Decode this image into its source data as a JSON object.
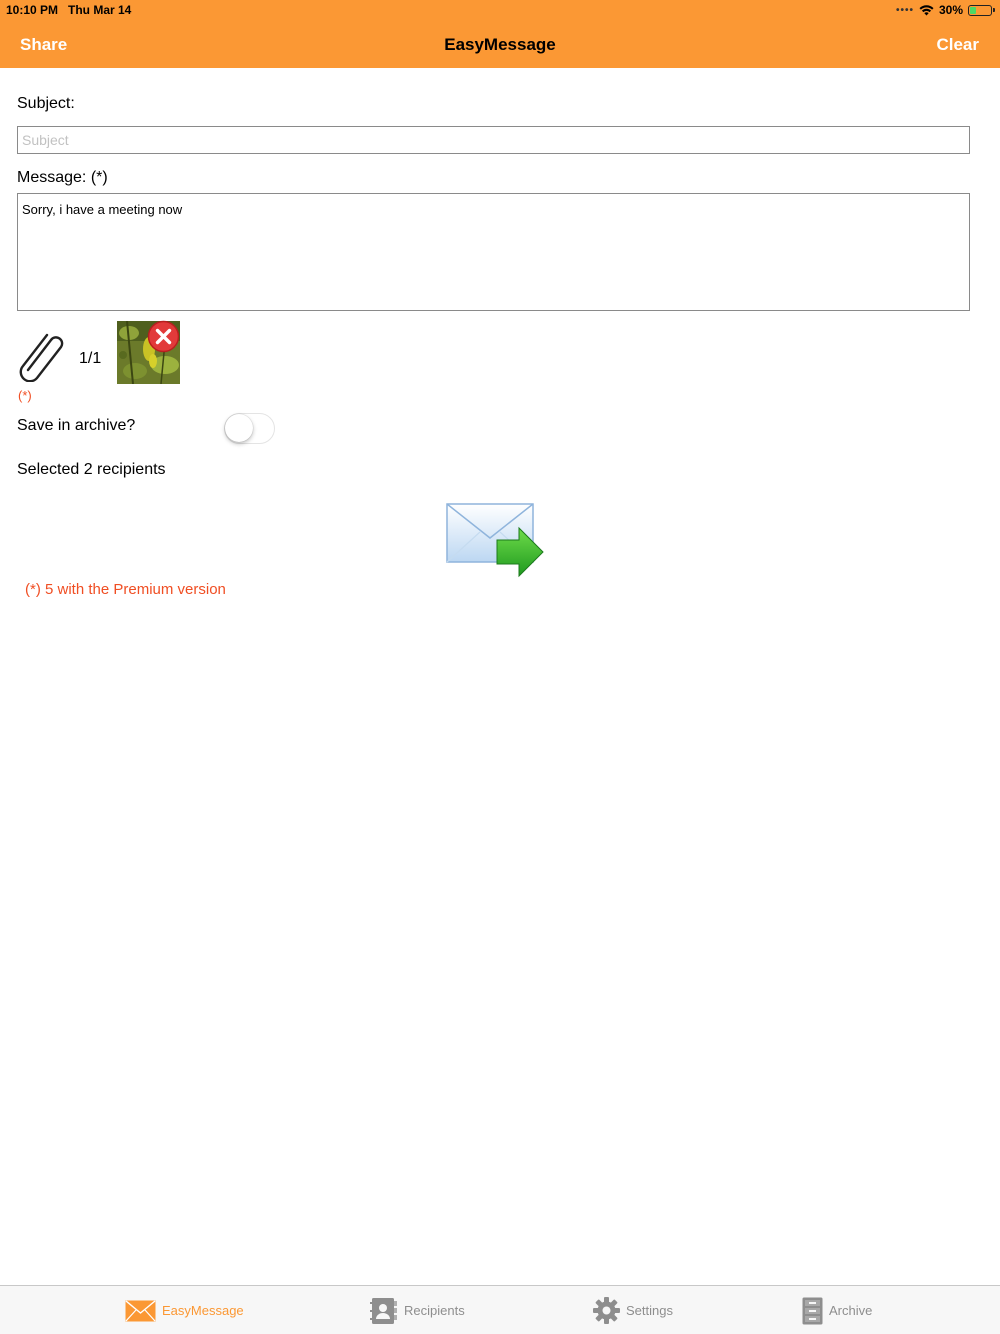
{
  "status_bar": {
    "time": "10:10 PM",
    "date": "Thu Mar 14",
    "battery": "30%",
    "battery_level": 0.3,
    "signal_icon": "signal-dots-icon",
    "wifi_icon": "wifi-icon",
    "battery_icon": "battery-icon"
  },
  "nav": {
    "left_button": "Share",
    "title": "EasyMessage",
    "right_button": "Clear",
    "bar_color": "#FB9834"
  },
  "form": {
    "subject_label": "Subject:",
    "subject_value": "",
    "subject_placeholder": "Subject",
    "message_label": "Message: (*)",
    "message_value": "Sorry, i have a meeting now",
    "attachment_icon": "paperclip-icon",
    "attachment_count": "1/1",
    "remove_icon": "remove-x-icon",
    "attachment_marker": "(*)",
    "archive_label": "Save in archive?",
    "archive_enabled": false,
    "recipients_label": "Selected 2 recipients",
    "send_icon": "send-mail-icon",
    "premium_note": "(*) 5 with the Premium version",
    "accent_red": "#F04E23"
  },
  "tabs": [
    {
      "label": "EasyMessage",
      "icon": "envelope-icon",
      "active": true
    },
    {
      "label": "Recipients",
      "icon": "contacts-icon",
      "active": false
    },
    {
      "label": "Settings",
      "icon": "gear-icon",
      "active": false
    },
    {
      "label": "Archive",
      "icon": "cabinet-icon",
      "active": false
    }
  ]
}
